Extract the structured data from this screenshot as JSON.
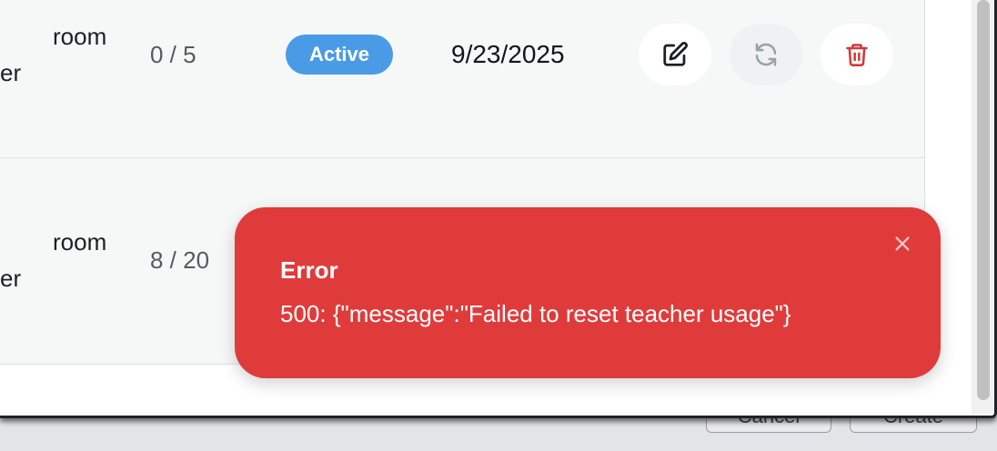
{
  "footer": {
    "cancel_label": "Cancel",
    "create_label": "Create"
  },
  "rows": [
    {
      "name_line1": "room",
      "name_line2": "er",
      "usage": "0 / 5",
      "status": "Active",
      "date": "9/23/2025"
    },
    {
      "name_line1": "room",
      "name_line2": "er",
      "usage": "8 / 20"
    }
  ],
  "actions": {
    "edit_icon": "edit-icon",
    "reset_icon": "refresh-icon",
    "delete_icon": "trash-icon"
  },
  "colors": {
    "badge": "#4a9be6",
    "toast": "#e03b3b",
    "delete": "#d03a3a"
  },
  "toast": {
    "title": "Error",
    "message": "500: {\"message\":\"Failed to reset teacher usage\"}"
  }
}
